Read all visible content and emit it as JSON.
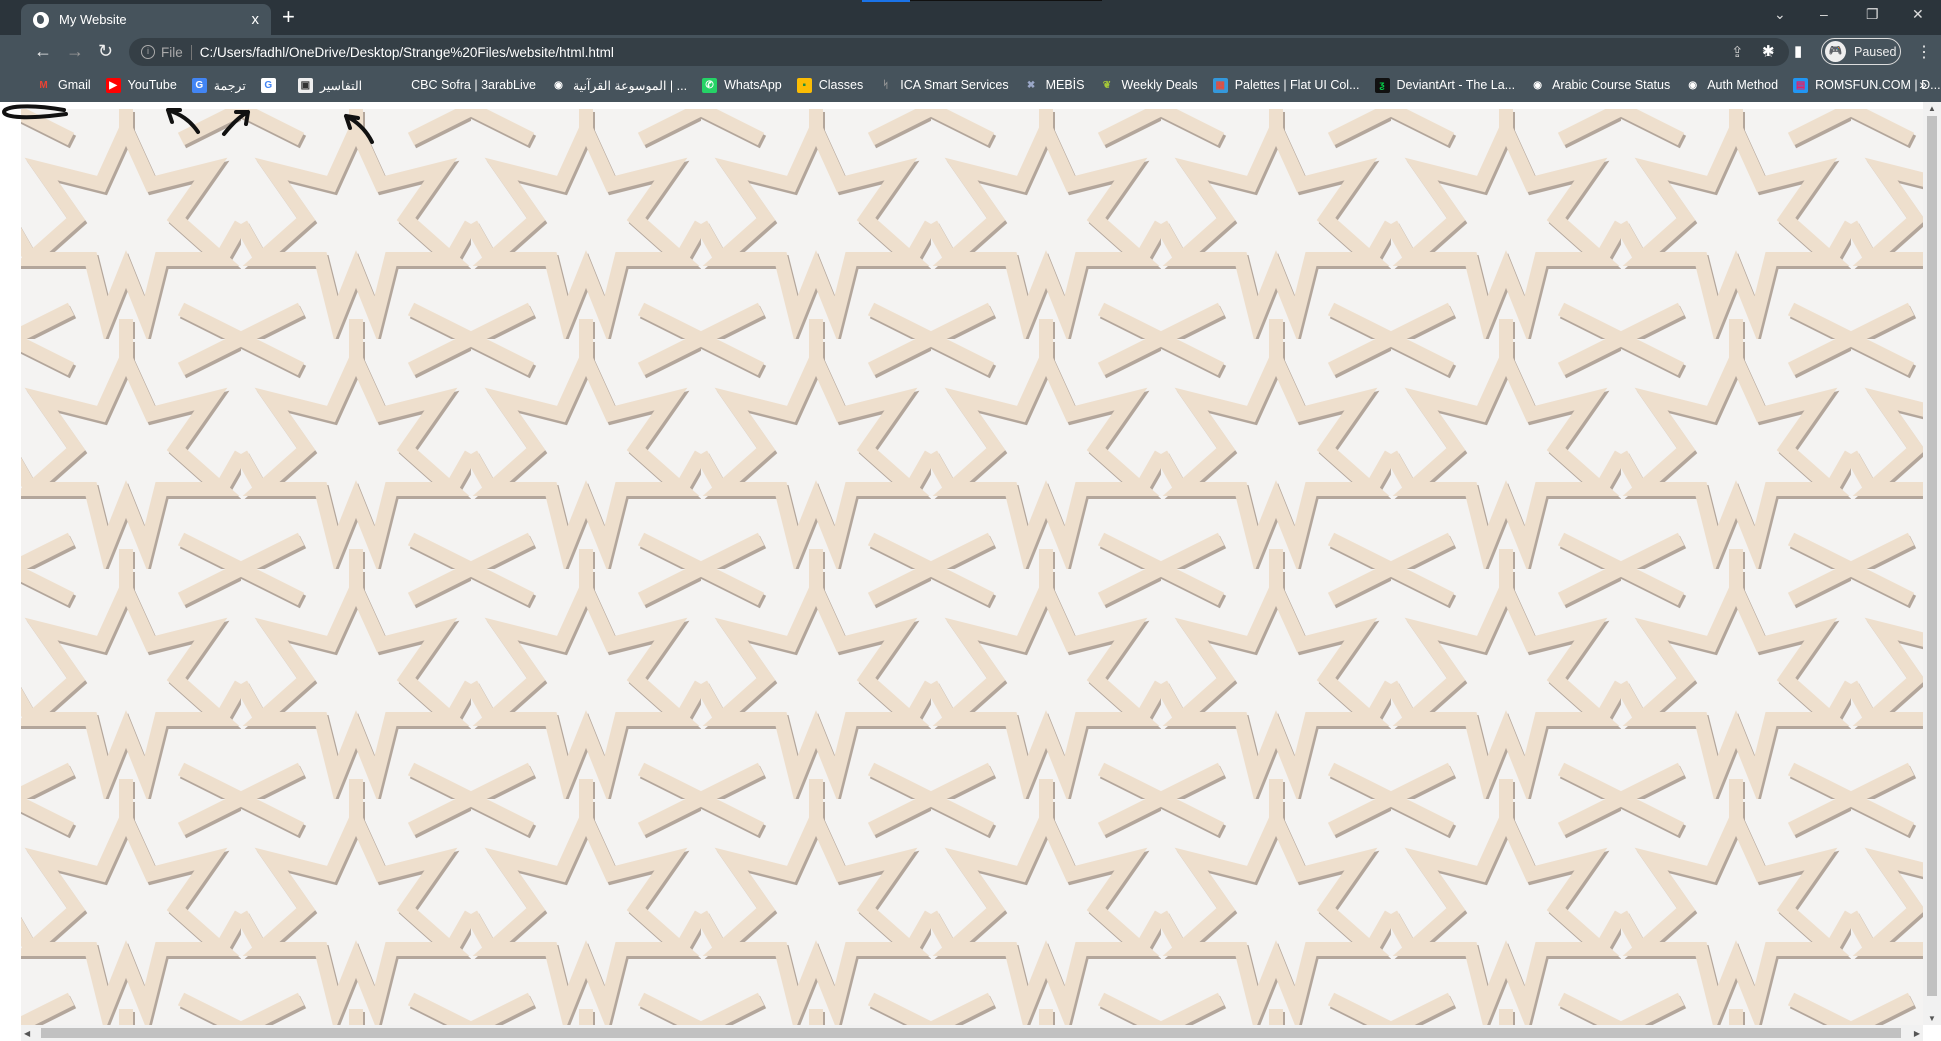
{
  "tab": {
    "title": "My Website",
    "close": "x",
    "new_tab": "+"
  },
  "window": {
    "tab_search": "⌄",
    "minimize": "–",
    "restore": "❐",
    "close": "✕"
  },
  "toolbar": {
    "back": "←",
    "forward": "→",
    "reload": "↻",
    "info": "i",
    "scheme": "File",
    "url": "C:/Users/fadhl/OneDrive/Desktop/Strange%20Files/website/html.html",
    "share": "⇪",
    "bookmark_star": "☆",
    "extensions": "✱",
    "side_panel": "▮",
    "profile_label": "Paused",
    "menu": "⋮"
  },
  "bookmarks": [
    {
      "label": "Gmail",
      "icon": "gmail-icon",
      "glyph": "M",
      "color": "#ea4335",
      "bg": "transparent"
    },
    {
      "label": "YouTube",
      "icon": "youtube-icon",
      "glyph": "▶",
      "color": "#fff",
      "bg": "#ff0000"
    },
    {
      "label": "ترجمة",
      "icon": "google-translate-icon",
      "glyph": "G",
      "color": "#fff",
      "bg": "#4285f4"
    },
    {
      "label": "",
      "icon": "google-icon",
      "glyph": "G",
      "color": "#4285f4",
      "bg": "#fff"
    },
    {
      "label": "التفاسير",
      "icon": "book-icon",
      "glyph": "▣",
      "color": "#333",
      "bg": "#eee"
    },
    {
      "label": "CBC Sofra | 3arabLive",
      "icon": "cbc-icon",
      "glyph": "",
      "color": "#fff",
      "bg": "transparent"
    },
    {
      "label": "الموسوعة القرآنية | ...",
      "icon": "globe-icon",
      "glyph": "◉",
      "color": "#fff",
      "bg": "transparent"
    },
    {
      "label": "WhatsApp",
      "icon": "whatsapp-icon",
      "glyph": "✆",
      "color": "#fff",
      "bg": "#25d366"
    },
    {
      "label": "Classes",
      "icon": "classroom-icon",
      "glyph": "▪",
      "color": "#1e8e3e",
      "bg": "#fbbc04"
    },
    {
      "label": "ICA Smart Services",
      "icon": "ica-icon",
      "glyph": "ᛋ",
      "color": "#999",
      "bg": "transparent"
    },
    {
      "label": "MEBİS",
      "icon": "mebis-icon",
      "glyph": "✖",
      "color": "#9aa7c7",
      "bg": "transparent"
    },
    {
      "label": "Weekly Deals",
      "icon": "leaf-icon",
      "glyph": "❦",
      "color": "#a4c639",
      "bg": "transparent"
    },
    {
      "label": "Palettes | Flat UI Col...",
      "icon": "palette-icon",
      "glyph": "▦",
      "color": "#e74c3c",
      "bg": "#3498db"
    },
    {
      "label": "DeviantArt - The La...",
      "icon": "deviantart-icon",
      "glyph": "ƺ",
      "color": "#05cc47",
      "bg": "#111"
    },
    {
      "label": "Arabic Course Status",
      "icon": "globe-icon",
      "glyph": "◉",
      "color": "#fff",
      "bg": "transparent"
    },
    {
      "label": "Auth Method",
      "icon": "globe-icon",
      "glyph": "◉",
      "color": "#fff",
      "bg": "transparent"
    },
    {
      "label": "ROMSFUN.COM | D...",
      "icon": "romsfun-icon",
      "glyph": "▤",
      "color": "#e91e63",
      "bg": "#2196f3"
    }
  ],
  "bookmarks_more": "»",
  "colors": {
    "lattice": "#eedfcd",
    "lattice_shadow": "#7d6553",
    "background": "#f4f3f2"
  }
}
